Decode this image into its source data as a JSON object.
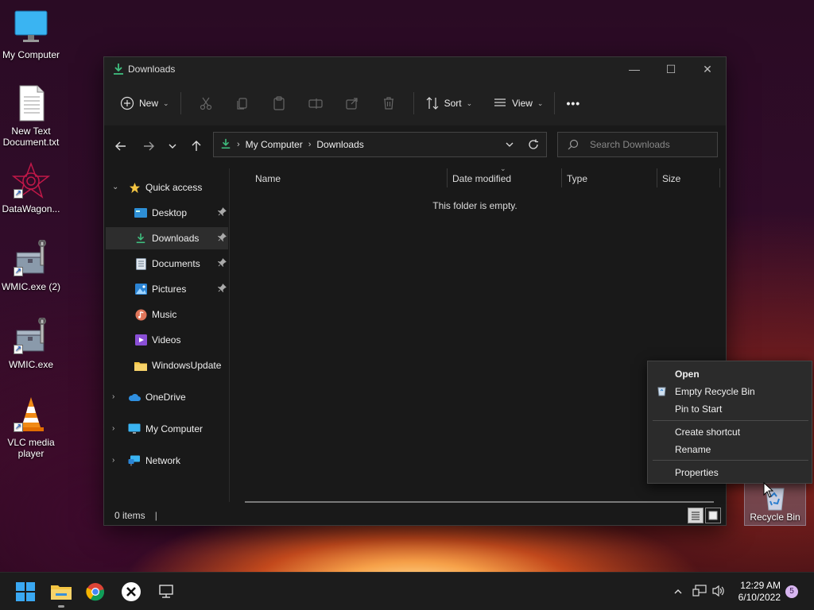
{
  "desktop": {
    "icons": [
      {
        "label": "My Computer",
        "icon": "monitor-icon"
      },
      {
        "label": "New Text Document.txt",
        "icon": "text-document-icon"
      },
      {
        "label": "DataWagon...",
        "icon": "datawagon-icon"
      },
      {
        "label": "WMIC.exe (2)",
        "icon": "wmic-tool-icon"
      },
      {
        "label": "WMIC.exe",
        "icon": "wmic-tool-icon"
      },
      {
        "label": "VLC media player",
        "icon": "vlc-cone-icon"
      }
    ],
    "recycle_bin": {
      "label": "Recycle Bin"
    }
  },
  "window": {
    "title": "Downloads",
    "toolbar": {
      "new_label": "New",
      "sort_label": "Sort",
      "view_label": "View",
      "more_label": "•••"
    },
    "address": {
      "crumbs": [
        "My Computer",
        "Downloads"
      ]
    },
    "search": {
      "placeholder": "Search Downloads"
    },
    "sidebar": {
      "quick_access": "Quick access",
      "items": [
        {
          "label": "Desktop",
          "pinned": true
        },
        {
          "label": "Downloads",
          "pinned": true,
          "selected": true
        },
        {
          "label": "Documents",
          "pinned": true
        },
        {
          "label": "Pictures",
          "pinned": true
        },
        {
          "label": "Music",
          "pinned": false
        },
        {
          "label": "Videos",
          "pinned": false
        },
        {
          "label": "WindowsUpdate",
          "pinned": false
        }
      ],
      "onedrive": "OneDrive",
      "my_computer": "My Computer",
      "network": "Network"
    },
    "columns": [
      "Name",
      "Date modified",
      "Type",
      "Size"
    ],
    "empty_message": "This folder is empty.",
    "status": {
      "items": "0 items"
    }
  },
  "context_menu": {
    "items": [
      "Open",
      "Empty Recycle Bin",
      "Pin to Start",
      "Create shortcut",
      "Rename",
      "Properties"
    ]
  },
  "taskbar": {
    "clock_time": "12:29 AM",
    "clock_date": "6/10/2022",
    "notification_count": "5"
  },
  "colors": {
    "accent_green": "#3fbf7f",
    "folder_yellow": "#f4c542",
    "window_bg": "#191919"
  }
}
